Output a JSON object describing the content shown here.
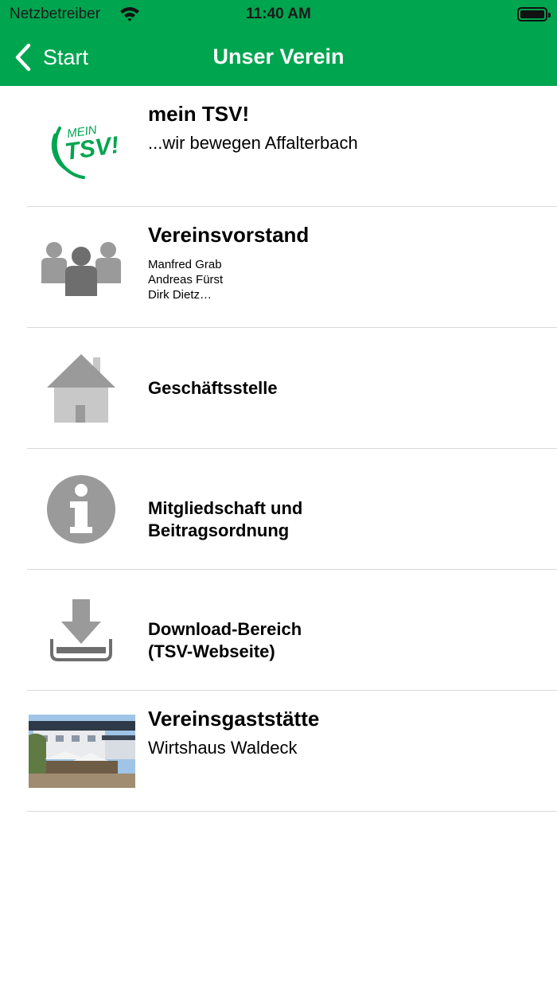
{
  "status_bar": {
    "carrier": "Netzbetreiber",
    "time": "11:40 AM"
  },
  "nav": {
    "back_label": "Start",
    "title": "Unser Verein"
  },
  "colors": {
    "brand_green": "#00a54f",
    "icon_gray": "#9a9a9a"
  },
  "items": [
    {
      "icon": "mein-tsv-logo",
      "logo_text_top": "MEIN",
      "logo_text_main": "TSV!",
      "title": "mein TSV!",
      "subtitle": "...wir bewegen Affalterbach"
    },
    {
      "icon": "people-icon",
      "title": "Vereinsvorstand",
      "lines": [
        "Manfred Grab",
        "Andreas Fürst",
        "Dirk Dietz…"
      ]
    },
    {
      "icon": "house-icon",
      "title": "Geschäftsstelle"
    },
    {
      "icon": "info-icon",
      "title_line1": "Mitgliedschaft und",
      "title_line2": "Beitragsordnung"
    },
    {
      "icon": "download-icon",
      "title_line1": "Download-Bereich",
      "title_line2": "(TSV-Webseite)"
    },
    {
      "icon": "restaurant-photo",
      "title": "Vereinsgaststätte",
      "subtitle": "Wirtshaus Waldeck"
    }
  ]
}
